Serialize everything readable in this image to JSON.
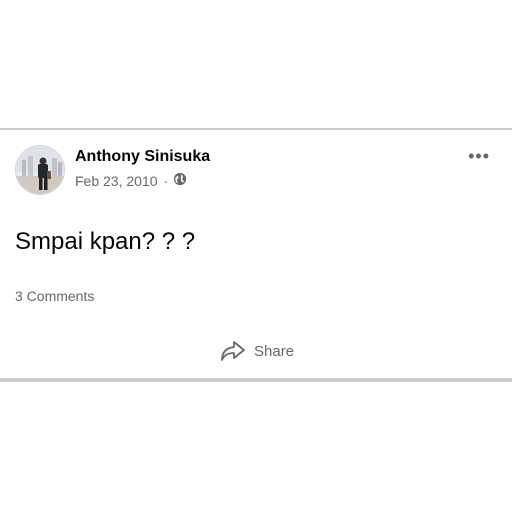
{
  "post": {
    "author": "Anthony Sinisuka",
    "date": "Feb 23, 2010",
    "dot": "·",
    "text": "Smpai kpan? ? ?",
    "comments": "3 Comments",
    "share_label": "Share",
    "more_label": "•••"
  },
  "icons": {
    "globe": "globe-icon",
    "share": "share-arrow-icon",
    "more": "more-options-icon"
  },
  "colors": {
    "secondary_text": "#65676b",
    "divider": "#c9cbcf"
  }
}
